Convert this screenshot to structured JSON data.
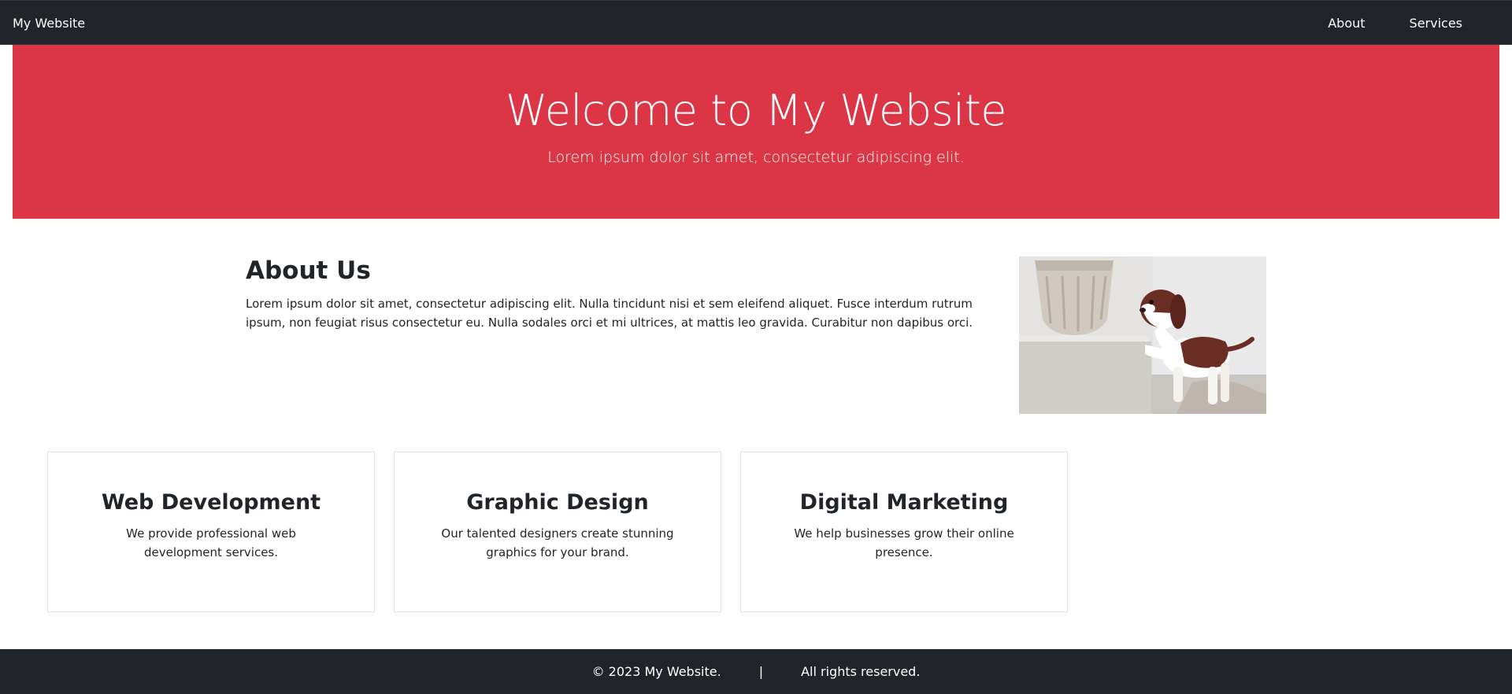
{
  "navbar": {
    "brand": "My Website",
    "links": [
      {
        "label": "About"
      },
      {
        "label": "Services"
      }
    ],
    "background": "#212529"
  },
  "hero": {
    "title": "Welcome to My Website",
    "subtitle": "Lorem ipsum dolor sit amet, consectetur adipiscing elit.",
    "background": "#dc3545"
  },
  "about": {
    "heading": "About Us",
    "text": "Lorem ipsum dolor sit amet, consectetur adipiscing elit. Nulla tincidunt nisi et sem eleifend aliquet. Fusce interdum rutrum ipsum, non feugiat risus consectetur eu. Nulla sodales orci et mi ultrices, at mattis leo gravida. Curabitur non dapibus orci."
  },
  "services": [
    {
      "title": "Web Development",
      "text": "We provide professional web development services."
    },
    {
      "title": "Graphic Design",
      "text": "Our talented designers create stunning graphics for your brand."
    },
    {
      "title": "Digital Marketing",
      "text": "We help businesses grow their online presence."
    }
  ],
  "footer": {
    "copyright": "© 2023 My Website.",
    "separator": "|",
    "rights": "All rights reserved."
  }
}
